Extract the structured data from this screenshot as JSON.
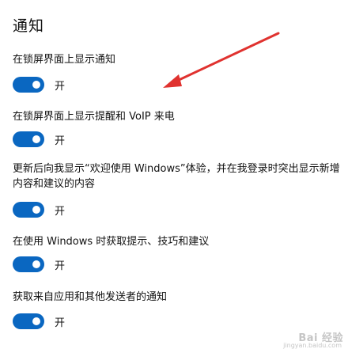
{
  "section_title": "通知",
  "toggle_state_label": "开",
  "settings": [
    {
      "label": "在锁屏界面上显示通知",
      "state": "开"
    },
    {
      "label": "在锁屏界面上显示提醒和 VoIP 来电",
      "state": "开"
    },
    {
      "label": "更新后向我显示“欢迎使用 Windows”体验，并在我登录时突出显示新增内容和建议的内容",
      "state": "开"
    },
    {
      "label": "在使用 Windows 时获取提示、技巧和建议",
      "state": "开"
    },
    {
      "label": "获取来自应用和其他发送者的通知",
      "state": "开"
    }
  ],
  "watermark": {
    "main": "Bai 经验",
    "sub": "jingyan.baidu.com"
  },
  "colors": {
    "toggle_on": "#0a67c1",
    "arrow": "#e0322f"
  }
}
